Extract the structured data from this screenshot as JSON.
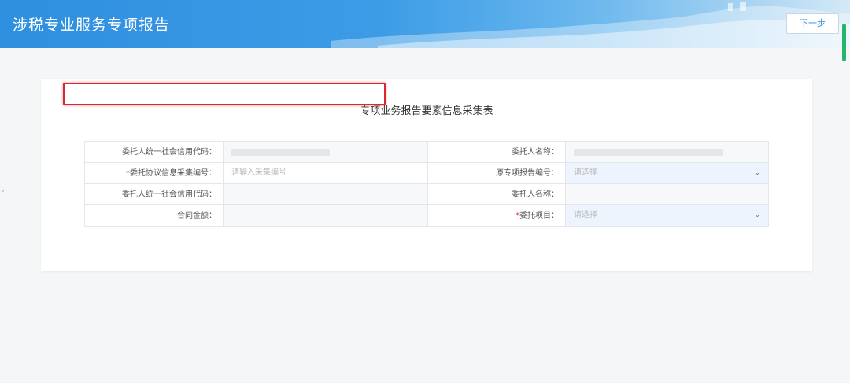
{
  "header": {
    "title": "涉税专业服务专项报告",
    "next_button": "下一步"
  },
  "form": {
    "title": "专项业务报告要素信息采集表",
    "rows": [
      {
        "left_label": "委托人统一社会信用代码：",
        "left_value": "",
        "right_label": "委托人名称：",
        "right_value": ""
      },
      {
        "left_required": "*",
        "left_label": "委托协议信息采集编号：",
        "left_placeholder": "请输入采集编号",
        "right_label": "原专项报告编号：",
        "right_placeholder": "请选择"
      },
      {
        "left_label": "委托人统一社会信用代码：",
        "left_value": "",
        "right_label": "委托人名称：",
        "right_value": ""
      },
      {
        "left_label": "合同金额：",
        "left_value": "",
        "right_required": "*",
        "right_label": "委托项目：",
        "right_placeholder": "请选择"
      }
    ]
  },
  "icons": {
    "chevron": "chevron-down-icon"
  }
}
